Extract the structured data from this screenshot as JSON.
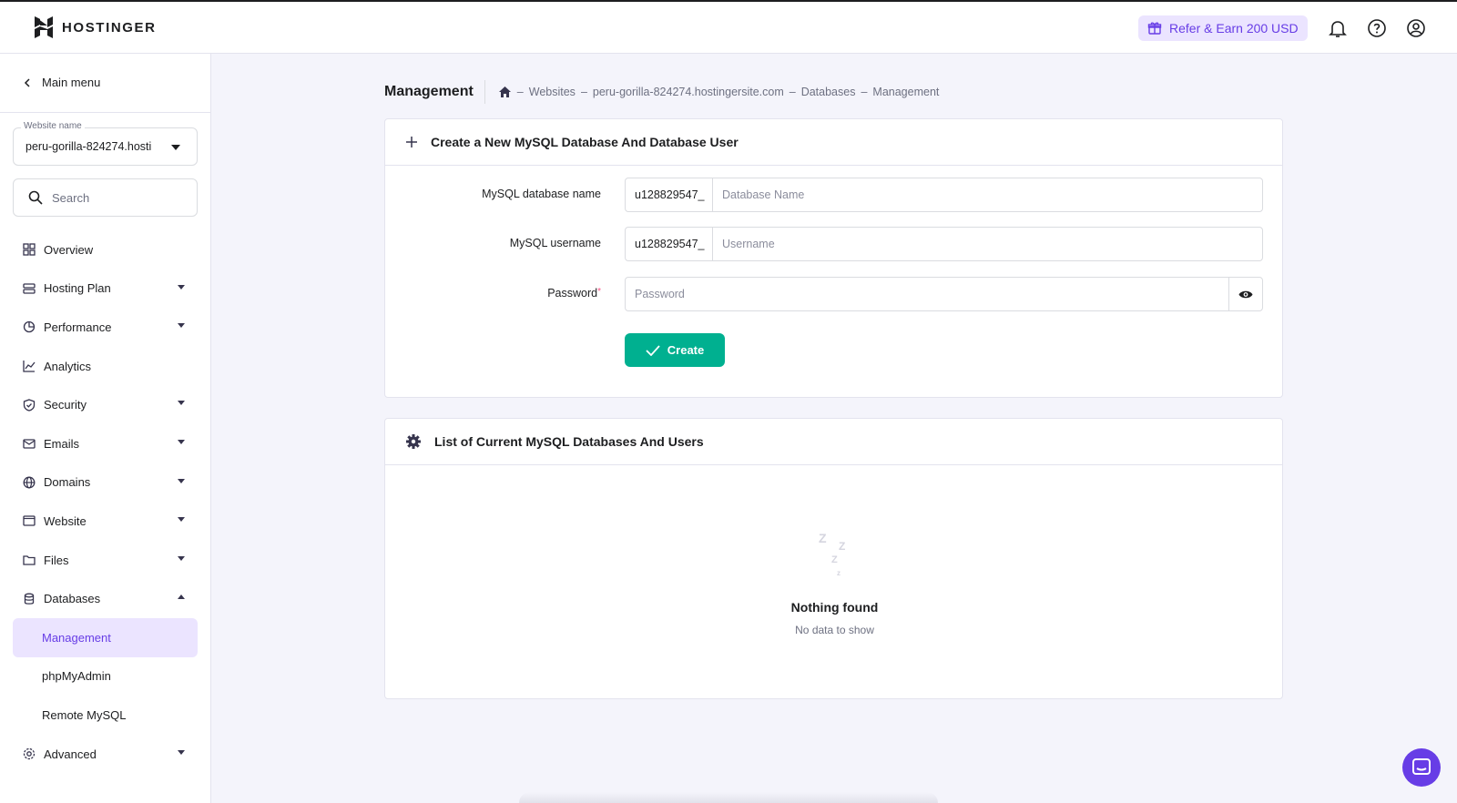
{
  "brand": {
    "name": "HOSTINGER"
  },
  "header": {
    "refer_label": "Refer & Earn 200 USD",
    "icons": [
      "gift-icon",
      "bell-icon",
      "help-icon",
      "account-icon"
    ]
  },
  "sidebar": {
    "main_menu_label": "Main menu",
    "website_label": "Website name",
    "website_value": "peru-gorilla-824274.hosti",
    "search_placeholder": "Search",
    "items": [
      {
        "label": "Overview",
        "icon": "overview-icon",
        "expandable": false
      },
      {
        "label": "Hosting Plan",
        "icon": "server-icon",
        "expandable": true
      },
      {
        "label": "Performance",
        "icon": "pie-chart-icon",
        "expandable": true
      },
      {
        "label": "Analytics",
        "icon": "analytics-icon",
        "expandable": false
      },
      {
        "label": "Security",
        "icon": "shield-icon",
        "expandable": true
      },
      {
        "label": "Emails",
        "icon": "mail-icon",
        "expandable": true
      },
      {
        "label": "Domains",
        "icon": "globe-icon",
        "expandable": true
      },
      {
        "label": "Website",
        "icon": "window-icon",
        "expandable": true
      },
      {
        "label": "Files",
        "icon": "folder-icon",
        "expandable": true
      },
      {
        "label": "Databases",
        "icon": "database-icon",
        "expandable": true,
        "expanded": true
      }
    ],
    "database_sub": [
      {
        "label": "Management",
        "active": true
      },
      {
        "label": "phpMyAdmin",
        "active": false
      },
      {
        "label": "Remote MySQL",
        "active": false
      }
    ],
    "advanced_label": "Advanced"
  },
  "main": {
    "title": "Management",
    "breadcrumb": [
      "Websites",
      "peru-gorilla-824274.hostingersite.com",
      "Databases",
      "Management"
    ],
    "breadcrumb_sep": "–",
    "create_card": {
      "title": "Create a New MySQL Database And Database User",
      "db_name_label": "MySQL database name",
      "db_prefix": "u128829547_",
      "db_placeholder": "Database Name",
      "username_label": "MySQL username",
      "username_prefix": "u128829547_",
      "username_placeholder": "Username",
      "password_label": "Password",
      "password_placeholder": "Password",
      "create_label": "Create"
    },
    "list_card": {
      "title": "List of Current MySQL Databases And Users",
      "empty_title": "Nothing found",
      "empty_sub": "No data to show"
    }
  },
  "colors": {
    "accent": "#673de6",
    "success": "#00b090",
    "active_bg": "#ebe4ff"
  }
}
